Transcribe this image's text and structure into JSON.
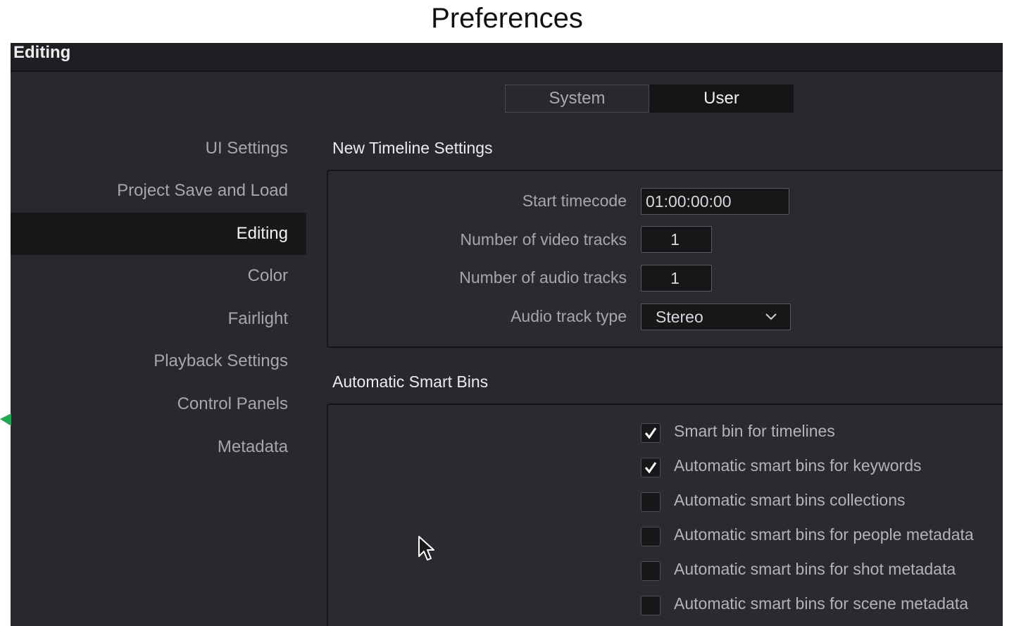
{
  "page_title": "Preferences",
  "header": {
    "title": "Editing"
  },
  "scope_tabs": {
    "system": "System",
    "user": "User",
    "active": "User"
  },
  "sidebar": {
    "items": [
      {
        "label": "UI Settings"
      },
      {
        "label": "Project Save and Load"
      },
      {
        "label": "Editing"
      },
      {
        "label": "Color"
      },
      {
        "label": "Fairlight"
      },
      {
        "label": "Playback Settings"
      },
      {
        "label": "Control Panels"
      },
      {
        "label": "Metadata"
      }
    ],
    "active": "Editing"
  },
  "new_timeline": {
    "title": "New Timeline Settings",
    "start_timecode": {
      "label": "Start timecode",
      "value": "01:00:00:00"
    },
    "video_tracks": {
      "label": "Number of video tracks",
      "value": "1"
    },
    "audio_tracks": {
      "label": "Number of audio tracks",
      "value": "1"
    },
    "audio_track_type": {
      "label": "Audio track type",
      "value": "Stereo"
    }
  },
  "smart_bins": {
    "title": "Automatic Smart Bins",
    "options": [
      {
        "label": "Smart bin for timelines",
        "checked": true
      },
      {
        "label": "Automatic smart bins for keywords",
        "checked": true
      },
      {
        "label": "Automatic smart bins collections",
        "checked": false
      },
      {
        "label": "Automatic smart bins for people metadata",
        "checked": false
      },
      {
        "label": "Automatic smart bins for shot metadata",
        "checked": false
      },
      {
        "label": "Automatic smart bins for scene metadata",
        "checked": false
      }
    ]
  },
  "colors": {
    "background": "#28282e",
    "header": "#1f1f23",
    "active_item": "#18181b",
    "annotation_arrow": "#1faa4f"
  }
}
